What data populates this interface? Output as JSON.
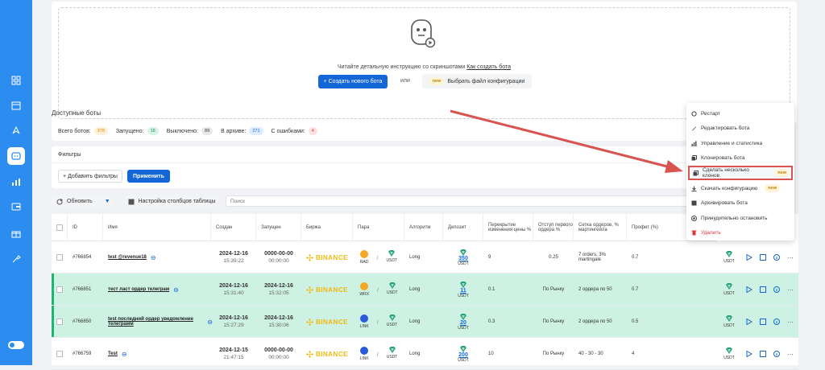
{
  "colors": {
    "primary": "#1366d6",
    "sidebar": "#2d8cf0",
    "active_row": "#cdf1e2",
    "binance": "#f0b90b",
    "delete": "#e0363a",
    "arrow": "#d9534f"
  },
  "create": {
    "instruction_text": "Читайте детальную инструкцию со скриншотами",
    "instruction_link": "Как создать бота",
    "create_button": "+ Создать нового бота",
    "or_label": "или",
    "new_badge": "new",
    "choose_config_button": "Выбрать файл конфигурации"
  },
  "available_title": "Доступные боты",
  "stats": [
    {
      "label": "Всего ботов:",
      "value": "378",
      "bg": "#fff0d9",
      "fg": "#d98b00"
    },
    {
      "label": "Запущено:",
      "value": "18",
      "bg": "#d6f3e6",
      "fg": "#1a9b5a"
    },
    {
      "label": "Выключено:",
      "value": "89",
      "bg": "#e6e8eb",
      "fg": "#333"
    },
    {
      "label": "В архиве:",
      "value": "271",
      "bg": "#dcebff",
      "fg": "#1366d6"
    },
    {
      "label": "С ошибками:",
      "value": "4",
      "bg": "#ffe1e1",
      "fg": "#e0363a"
    }
  ],
  "filters": {
    "title": "Фильтры",
    "add_button": "+ Добавить фильтры",
    "apply_button": "Применить"
  },
  "toolbar": {
    "refresh": "Обновить",
    "columns": "Настройка столбцов таблицы",
    "search_placeholder": "Поиск"
  },
  "table": {
    "headers": [
      "ID",
      "Имя",
      "Создан",
      "Запущен",
      "Биржа",
      "Пара",
      "Алгоритм",
      "Депозит",
      "Перекрытие изменения цены %",
      "Отступ первого ордера %",
      "Сетка ордеров, % мартингейла",
      "Профит (%)"
    ],
    "rows": [
      {
        "id": "#766854",
        "name": "test @revenue18",
        "created_date": "2024-12-16",
        "created_time": "15:39:22",
        "started_date": "0000-00-00",
        "started_time": "00:00:00",
        "exchange": "BINANCE",
        "base": "RAD",
        "quote": "USDT",
        "algo": "Long",
        "deposit": "350",
        "deposit_cur": "USDT",
        "overlap": "9",
        "indent": "0.25",
        "grid": "7 orders, 3% martingale",
        "profit": "0.7",
        "fee_cur": "USDT",
        "active": false,
        "base_color": "#f5a623"
      },
      {
        "id": "#766851",
        "name": "тест ласт ордер телеграм",
        "created_date": "2024-12-16",
        "created_time": "15:31:40",
        "started_date": "2024-12-16",
        "started_time": "15:32:05",
        "exchange": "BINANCE",
        "base": "WRX",
        "quote": "USDT",
        "algo": "Long",
        "deposit": "11",
        "deposit_cur": "USDT",
        "overlap": "0.1",
        "indent": "По Рынку",
        "grid": "2 ордера по 50",
        "profit": "0.7",
        "fee_cur": "USDT",
        "active": true,
        "base_color": "#f5a623"
      },
      {
        "id": "#766850",
        "name": "test последний ордер уведомление телеграмм",
        "created_date": "2024-12-16",
        "created_time": "15:27:29",
        "started_date": "2024-12-16",
        "started_time": "15:30:06",
        "exchange": "BINANCE",
        "base": "LINK",
        "quote": "USDT",
        "algo": "Long",
        "deposit": "20",
        "deposit_cur": "USDT",
        "overlap": "0.3",
        "indent": "По Рынку",
        "grid": "2 ордера по 50",
        "profit": "0.5",
        "fee_cur": "USDT",
        "active": true,
        "base_color": "#2a5ada"
      },
      {
        "id": "#766759",
        "name": "Test",
        "created_date": "2024-12-15",
        "created_time": "21:47:15",
        "started_date": "0000-00-00",
        "started_time": "00:00:00",
        "exchange": "BINANCE",
        "base": "LINK",
        "quote": "USDT",
        "algo": "Long",
        "deposit": "200",
        "deposit_cur": "USDT",
        "overlap": "10",
        "indent": "По Рынку",
        "grid": "40 - 30 - 30",
        "profit": "4",
        "fee_cur": "USDT",
        "active": false,
        "base_color": "#2a5ada"
      }
    ]
  },
  "context_menu": [
    {
      "label": "Рестарт",
      "icon": "restart-icon"
    },
    {
      "label": "Редактировать бота",
      "icon": "pencil-icon"
    },
    {
      "label": "Управление и статистика",
      "icon": "stats-icon"
    },
    {
      "label": "Клонировать бота",
      "icon": "clone-icon"
    },
    {
      "label": "Сделать несколько клонов",
      "icon": "multi-clone-icon",
      "badge": "new",
      "highlighted": true
    },
    {
      "label": "Скачать конфигурацию",
      "icon": "download-icon",
      "badge": "new"
    },
    {
      "label": "Архивировать бота",
      "icon": "archive-icon"
    },
    {
      "label": "Принудительно остановить",
      "icon": "stop-circle-icon"
    },
    {
      "label": "Удалить",
      "icon": "trash-icon",
      "danger": true
    }
  ]
}
